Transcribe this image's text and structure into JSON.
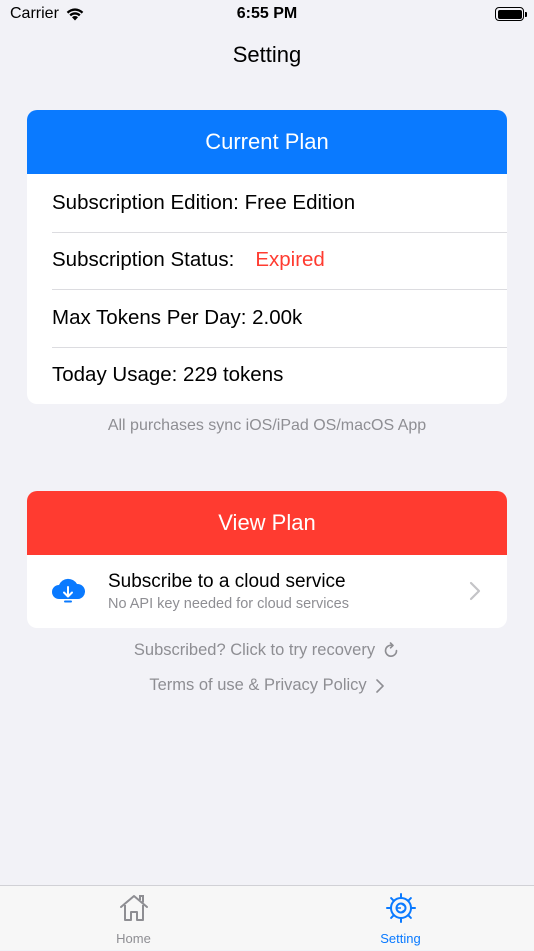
{
  "status_bar": {
    "carrier": "Carrier",
    "time": "6:55 PM"
  },
  "nav": {
    "title": "Setting"
  },
  "current_plan": {
    "header": "Current Plan",
    "edition": "Subscription Edition: Free Edition",
    "status_label": "Subscription Status:",
    "status_value": "Expired",
    "max_tokens": "Max Tokens Per Day: 2.00k",
    "today_usage": "Today Usage: 229 tokens"
  },
  "sync_note": "All purchases sync iOS/iPad OS/macOS App",
  "view_plan": {
    "button_label": "View Plan",
    "cloud_title": "Subscribe to a cloud service",
    "cloud_subtitle": "No API key needed for cloud services"
  },
  "links": {
    "recovery": "Subscribed? Click to try recovery",
    "terms": "Terms of use & Privacy Policy"
  },
  "tabs": [
    {
      "label": "Home",
      "icon": "house-icon",
      "active": false
    },
    {
      "label": "Setting",
      "icon": "gear-icon",
      "active": true
    }
  ],
  "colors": {
    "accent": "#0a7aff",
    "danger": "#ff3b30",
    "background": "#f2f2f7"
  }
}
